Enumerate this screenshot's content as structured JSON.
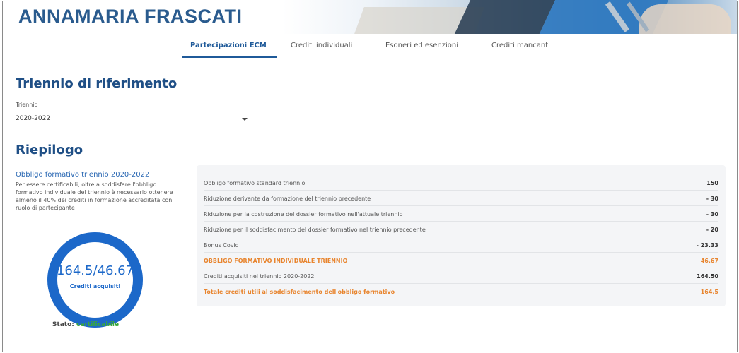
{
  "header": {
    "title": "ANNAMARIA FRASCATI"
  },
  "tabs": [
    {
      "label": "Partecipazioni ECM",
      "active": true
    },
    {
      "label": "Crediti individuali",
      "active": false
    },
    {
      "label": "Esoneri ed esenzioni",
      "active": false
    },
    {
      "label": "Crediti mancanti",
      "active": false
    }
  ],
  "triennio_section": {
    "title": "Triennio di riferimento",
    "field_label": "Triennio",
    "selected_value": "2020-2022"
  },
  "riepilogo": {
    "title": "Riepilogo",
    "obbligo_title": "Obbligo formativo triennio 2020-2022",
    "obbligo_text": "Per essere certificabili, oltre a soddisfare l'obbligo formativo individuale del triennio è necessario ottenere almeno il 40% dei crediti in formazione accreditata con ruolo di partecipante",
    "donut_value": "164.5/46.67",
    "donut_label": "Crediti acquisiti",
    "donut_fill": 1.0,
    "stato_label": "Stato:",
    "stato_value": "certificabile",
    "colors": {
      "accent": "#1c68c9",
      "ok": "#3aa83a",
      "highlight": "#e8852f"
    }
  },
  "summary_rows": [
    {
      "label": "Obbligo formativo standard triennio",
      "value": "150",
      "highlight": false
    },
    {
      "label": "Riduzione derivante da formazione del triennio precedente",
      "value": "- 30",
      "highlight": false
    },
    {
      "label": "Riduzione per la costruzione del dossier formativo nell'attuale triennio",
      "value": "- 30",
      "highlight": false
    },
    {
      "label": "Riduzione per il soddisfacimento del dossier formativo nel triennio precedente",
      "value": "- 20",
      "highlight": false
    },
    {
      "label": "Bonus Covid",
      "value": "- 23.33",
      "highlight": false
    },
    {
      "label": "OBBLIGO FORMATIVO INDIVIDUALE TRIENNIO",
      "value": "46.67",
      "highlight": true
    },
    {
      "label": "Crediti acquisiti nel triennio 2020-2022",
      "value": "164.50",
      "highlight": false
    },
    {
      "label": "Totale crediti utili al soddisfacimento dell'obbligo formativo",
      "value": "164.5",
      "highlight": true
    }
  ]
}
